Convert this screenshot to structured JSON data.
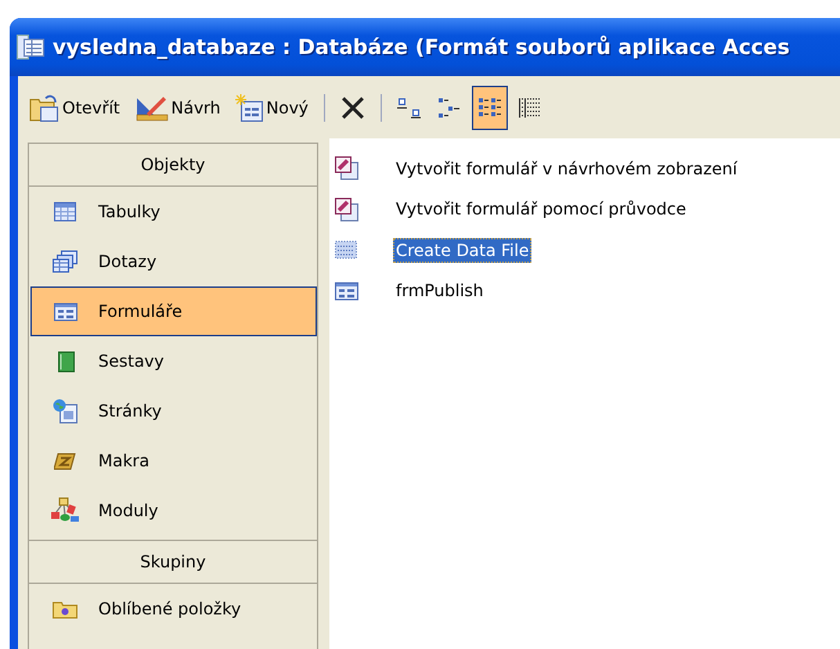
{
  "window": {
    "title": "vysledna_databaze : Databáze (Formát souborů aplikace Acces"
  },
  "toolbar": [
    {
      "kind": "open",
      "label": "Otevřít"
    },
    {
      "kind": "design",
      "label": "Návrh"
    },
    {
      "kind": "new",
      "label": "Nový"
    },
    {
      "kind": "separator"
    },
    {
      "kind": "delete"
    },
    {
      "kind": "separator"
    },
    {
      "kind": "large-icons",
      "selected": false
    },
    {
      "kind": "small-icons",
      "selected": false
    },
    {
      "kind": "list",
      "selected": true
    },
    {
      "kind": "details",
      "selected": false
    }
  ],
  "sidebar": {
    "sections": [
      {
        "title": "Objekty",
        "items": [
          {
            "kind": "table",
            "label": "Tabulky",
            "selected": false
          },
          {
            "kind": "query",
            "label": "Dotazy",
            "selected": false
          },
          {
            "kind": "form",
            "label": "Formuláře",
            "selected": true
          },
          {
            "kind": "report",
            "label": "Sestavy",
            "selected": false
          },
          {
            "kind": "page",
            "label": "Stránky",
            "selected": false
          },
          {
            "kind": "macro",
            "label": "Makra",
            "selected": false
          },
          {
            "kind": "module",
            "label": "Moduly",
            "selected": false
          }
        ]
      },
      {
        "title": "Skupiny",
        "items": [
          {
            "kind": "favorites",
            "label": "Oblíbené položky",
            "selected": false
          }
        ]
      }
    ]
  },
  "objects": [
    {
      "kind": "wizard",
      "label": "Vytvořit formulář v návrhovém zobrazení",
      "selected": false
    },
    {
      "kind": "wizard",
      "label": "Vytvořit formulář pomocí průvodce",
      "selected": false
    },
    {
      "kind": "dotted-form",
      "label": "Create Data File",
      "selected": true
    },
    {
      "kind": "form",
      "label": "frmPublish",
      "selected": false
    }
  ]
}
